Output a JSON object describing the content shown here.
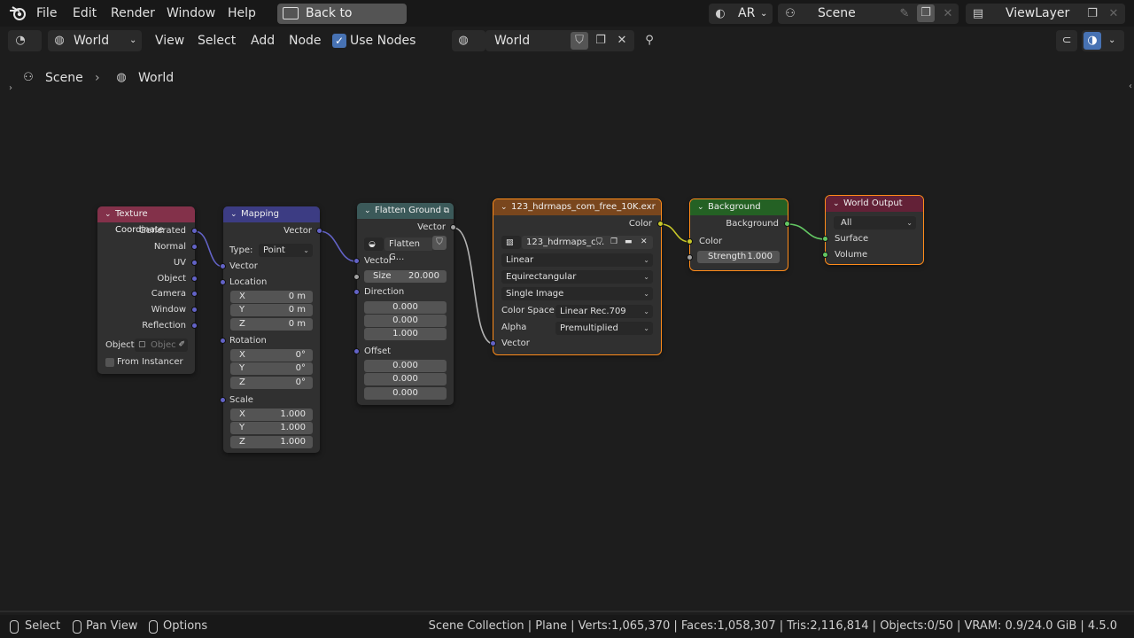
{
  "topbar": {
    "menus": [
      "File",
      "Edit",
      "Render",
      "Window",
      "Help"
    ],
    "back_label": "Back to Previous",
    "ar_label": "AR",
    "scene_label": "Scene",
    "viewlayer_label": "ViewLayer"
  },
  "header": {
    "editor_type": "World",
    "menus": [
      "View",
      "Select",
      "Add",
      "Node"
    ],
    "use_nodes_label": "Use Nodes",
    "world_name": "World"
  },
  "breadcrumb": {
    "scene": "Scene",
    "world": "World"
  },
  "nodes": {
    "tex_coord": {
      "title": "Texture Coordinate",
      "outputs": [
        "Generated",
        "Normal",
        "UV",
        "Object",
        "Camera",
        "Window",
        "Reflection"
      ],
      "object_label": "Object:",
      "object_placeholder": "Objec",
      "from_instancer": "From Instancer"
    },
    "mapping": {
      "title": "Mapping",
      "output": "Vector",
      "type_label": "Type:",
      "type_value": "Point",
      "vector": "Vector",
      "location": "Location",
      "loc": [
        [
          "X",
          "0 m"
        ],
        [
          "Y",
          "0 m"
        ],
        [
          "Z",
          "0 m"
        ]
      ],
      "rotation": "Rotation",
      "rot": [
        [
          "X",
          "0°"
        ],
        [
          "Y",
          "0°"
        ],
        [
          "Z",
          "0°"
        ]
      ],
      "scale": "Scale",
      "scl": [
        [
          "X",
          "1.000"
        ],
        [
          "Y",
          "1.000"
        ],
        [
          "Z",
          "1.000"
        ]
      ]
    },
    "flatten": {
      "title": "Flatten Ground",
      "output": "Vector",
      "group_name": "Flatten G...",
      "vector": "Vector",
      "size_label": "Size",
      "size_value": "20.000",
      "direction": "Direction",
      "dir": [
        "0.000",
        "0.000",
        "1.000"
      ],
      "offset": "Offset",
      "off": [
        "0.000",
        "0.000",
        "0.000"
      ]
    },
    "image": {
      "title": "123_hdrmaps_com_free_10K.exr",
      "output": "Color",
      "image_name": "123_hdrmaps_c...",
      "interp": "Linear",
      "projection": "Equirectangular",
      "source": "Single Image",
      "colorspace_label": "Color Space",
      "colorspace": "Linear Rec.709",
      "alpha_label": "Alpha",
      "alpha": "Premultiplied",
      "vector": "Vector"
    },
    "background": {
      "title": "Background",
      "output": "Background",
      "color": "Color",
      "strength_label": "Strength",
      "strength_value": "1.000"
    },
    "world_output": {
      "title": "World Output",
      "target": "All",
      "surface": "Surface",
      "volume": "Volume"
    }
  },
  "status": {
    "select": "Select",
    "pan": "Pan View",
    "options": "Options",
    "info": "Scene Collection | Plane | Verts:1,065,370 | Faces:1,058,307 | Tris:2,116,814 | Objects:0/50 | VRAM: 0.9/24.0 GiB | 4.5.0"
  },
  "colors": {
    "texcoord_header": "#83314a",
    "mapping_header": "#3c3c83",
    "flatten_header": "#3b5959",
    "image_header": "#79461d",
    "background_header": "#246124",
    "output_header": "#632137",
    "selection": "#ff8c1a",
    "vector_socket": "#6363c7",
    "color_socket": "#c7c729"
  }
}
